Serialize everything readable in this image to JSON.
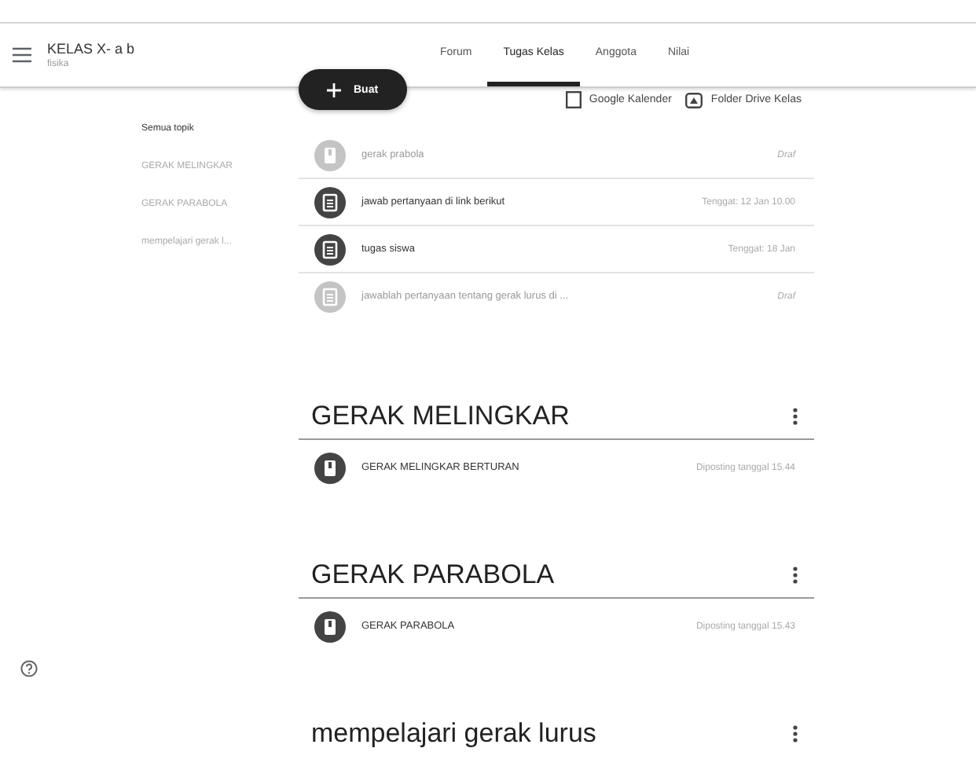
{
  "header": {
    "class_name": "KELAS X- a b",
    "subject": "fisika"
  },
  "tabs": [
    {
      "label": "Forum",
      "selected": false
    },
    {
      "label": "Tugas Kelas",
      "selected": true
    },
    {
      "label": "Anggota",
      "selected": false
    },
    {
      "label": "Nilai",
      "selected": false
    }
  ],
  "toolbar": {
    "create_button": "Buat",
    "calendar_link": "Google Kalender",
    "drive_link": "Folder Drive Kelas"
  },
  "topics": [
    {
      "label": "Semua topik",
      "selected": true
    },
    {
      "label": "GERAK MELINGKAR",
      "selected": false
    },
    {
      "label": "GERAK PARABOLA",
      "selected": false
    },
    {
      "label": "mempelajari gerak l...",
      "selected": false
    }
  ],
  "items": [
    {
      "kind": "material",
      "title": "gerak prabola",
      "status": "Draf",
      "draft": true
    },
    {
      "kind": "assignment",
      "title": "jawab pertanyaan di link berikut",
      "status": "Tenggat: 12 Jan 10.00",
      "draft": false
    },
    {
      "kind": "assignment",
      "title": "tugas siswa",
      "status": "Tenggat: 18 Jan",
      "draft": false
    },
    {
      "kind": "assignment",
      "title": "jawablah pertanyaan tentang gerak lurus di ...",
      "status": "Draf",
      "draft": true
    }
  ],
  "sections": [
    {
      "title": "GERAK MELINGKAR",
      "items": [
        {
          "kind": "material",
          "title": "GERAK MELINGKAR BERTURAN",
          "status": "Diposting tanggal 15.44",
          "draft": false
        }
      ]
    },
    {
      "title": "GERAK PARABOLA",
      "items": [
        {
          "kind": "material",
          "title": "GERAK PARABOLA",
          "status": "Diposting tanggal 15.43",
          "draft": false
        }
      ]
    },
    {
      "title": "mempelajari gerak lurus"
    }
  ]
}
